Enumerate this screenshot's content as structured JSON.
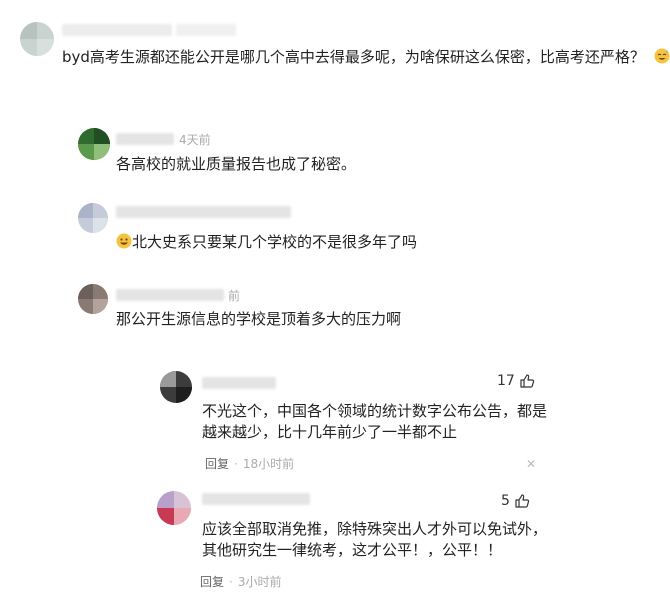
{
  "post": {
    "text": "byd高考生源都还能公开是哪几个高中去得最多呢，为啥保研这么保密，比高考还严格？"
  },
  "comments": [
    {
      "time": "4天前",
      "text": "各高校的就业质量报告也成了秘密。"
    },
    {
      "time": "",
      "text": "北大史系只要某几个学校的不是很多年了吗"
    },
    {
      "time": "前",
      "text": "那公开生源信息的学校是顶着多大的压力啊"
    }
  ],
  "replies": [
    {
      "likes": "17",
      "lines": [
        "不光这个，中国各个领域的统计数字公布公告，都是",
        "越来越少，比十几年前少了一半都不止"
      ],
      "reply_label": "回复",
      "time": "18小时前"
    },
    {
      "likes": "5",
      "lines": [
        "应该全部取消免推，除特殊突出人才外可以免试外，",
        "其他研究生一律统考，这才公平！，公平！！"
      ],
      "reply_label": "回复",
      "time": "3小时前"
    }
  ],
  "icons": {
    "like": "thumbs-up-icon",
    "close": "close-icon",
    "emoji_post": "sweat-smile-emoji",
    "emoji_comment": "grin-emoji"
  }
}
